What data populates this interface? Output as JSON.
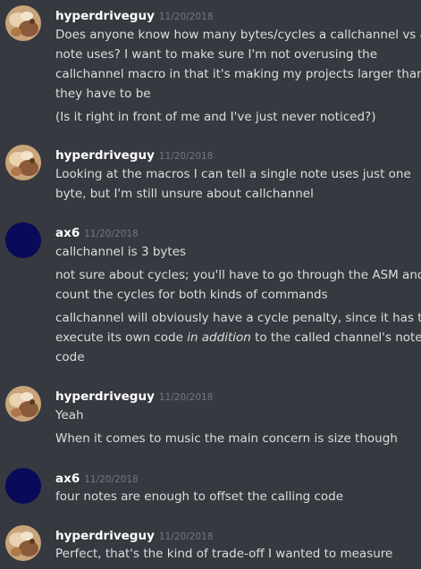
{
  "colors": {
    "background": "#36393f",
    "text": "#dcddde",
    "username": "#ffffff",
    "timestamp": "#72767d",
    "ax6_avatar": "#0a0a5a"
  },
  "groups": [
    {
      "author": "hyperdriveguy",
      "timestamp": "11/20/2018",
      "avatar": "food-photo-avatar",
      "lines": [
        "Does anyone know how many bytes/cycles a callchannel vs a",
        "note uses? I want to make sure I'm not overusing the",
        "callchannel macro in that it's making my projects larger than",
        "they have to be",
        "(Is it right in front of me and I've just never noticed?)"
      ]
    },
    {
      "author": "hyperdriveguy",
      "timestamp": "11/20/2018",
      "avatar": "food-photo-avatar",
      "lines": [
        "Looking at the macros I can tell a single note uses just one",
        "byte, but I'm still unsure about callchannel"
      ]
    },
    {
      "author": "ax6",
      "timestamp": "11/20/2018",
      "avatar": "dark-blue-circle-avatar",
      "lines": [
        "callchannel is 3 bytes",
        "not sure about cycles; you'll have to go through the ASM and",
        "count the cycles for both kinds of commands",
        "callchannel will obviously have a cycle penalty, since it has to",
        {
          "before": "execute its own code ",
          "italic": "in addition",
          "after": " to the called channel's notes'"
        },
        "code"
      ]
    },
    {
      "author": "hyperdriveguy",
      "timestamp": "11/20/2018",
      "avatar": "food-photo-avatar",
      "lines": [
        "Yeah",
        "When it comes to music the main concern is size though"
      ]
    },
    {
      "author": "ax6",
      "timestamp": "11/20/2018",
      "avatar": "dark-blue-circle-avatar",
      "lines": [
        "four notes are enough to offset the calling code"
      ]
    },
    {
      "author": "hyperdriveguy",
      "timestamp": "11/20/2018",
      "avatar": "food-photo-avatar",
      "lines": [
        "Perfect, that's the kind of trade-off I wanted to measure"
      ]
    }
  ]
}
